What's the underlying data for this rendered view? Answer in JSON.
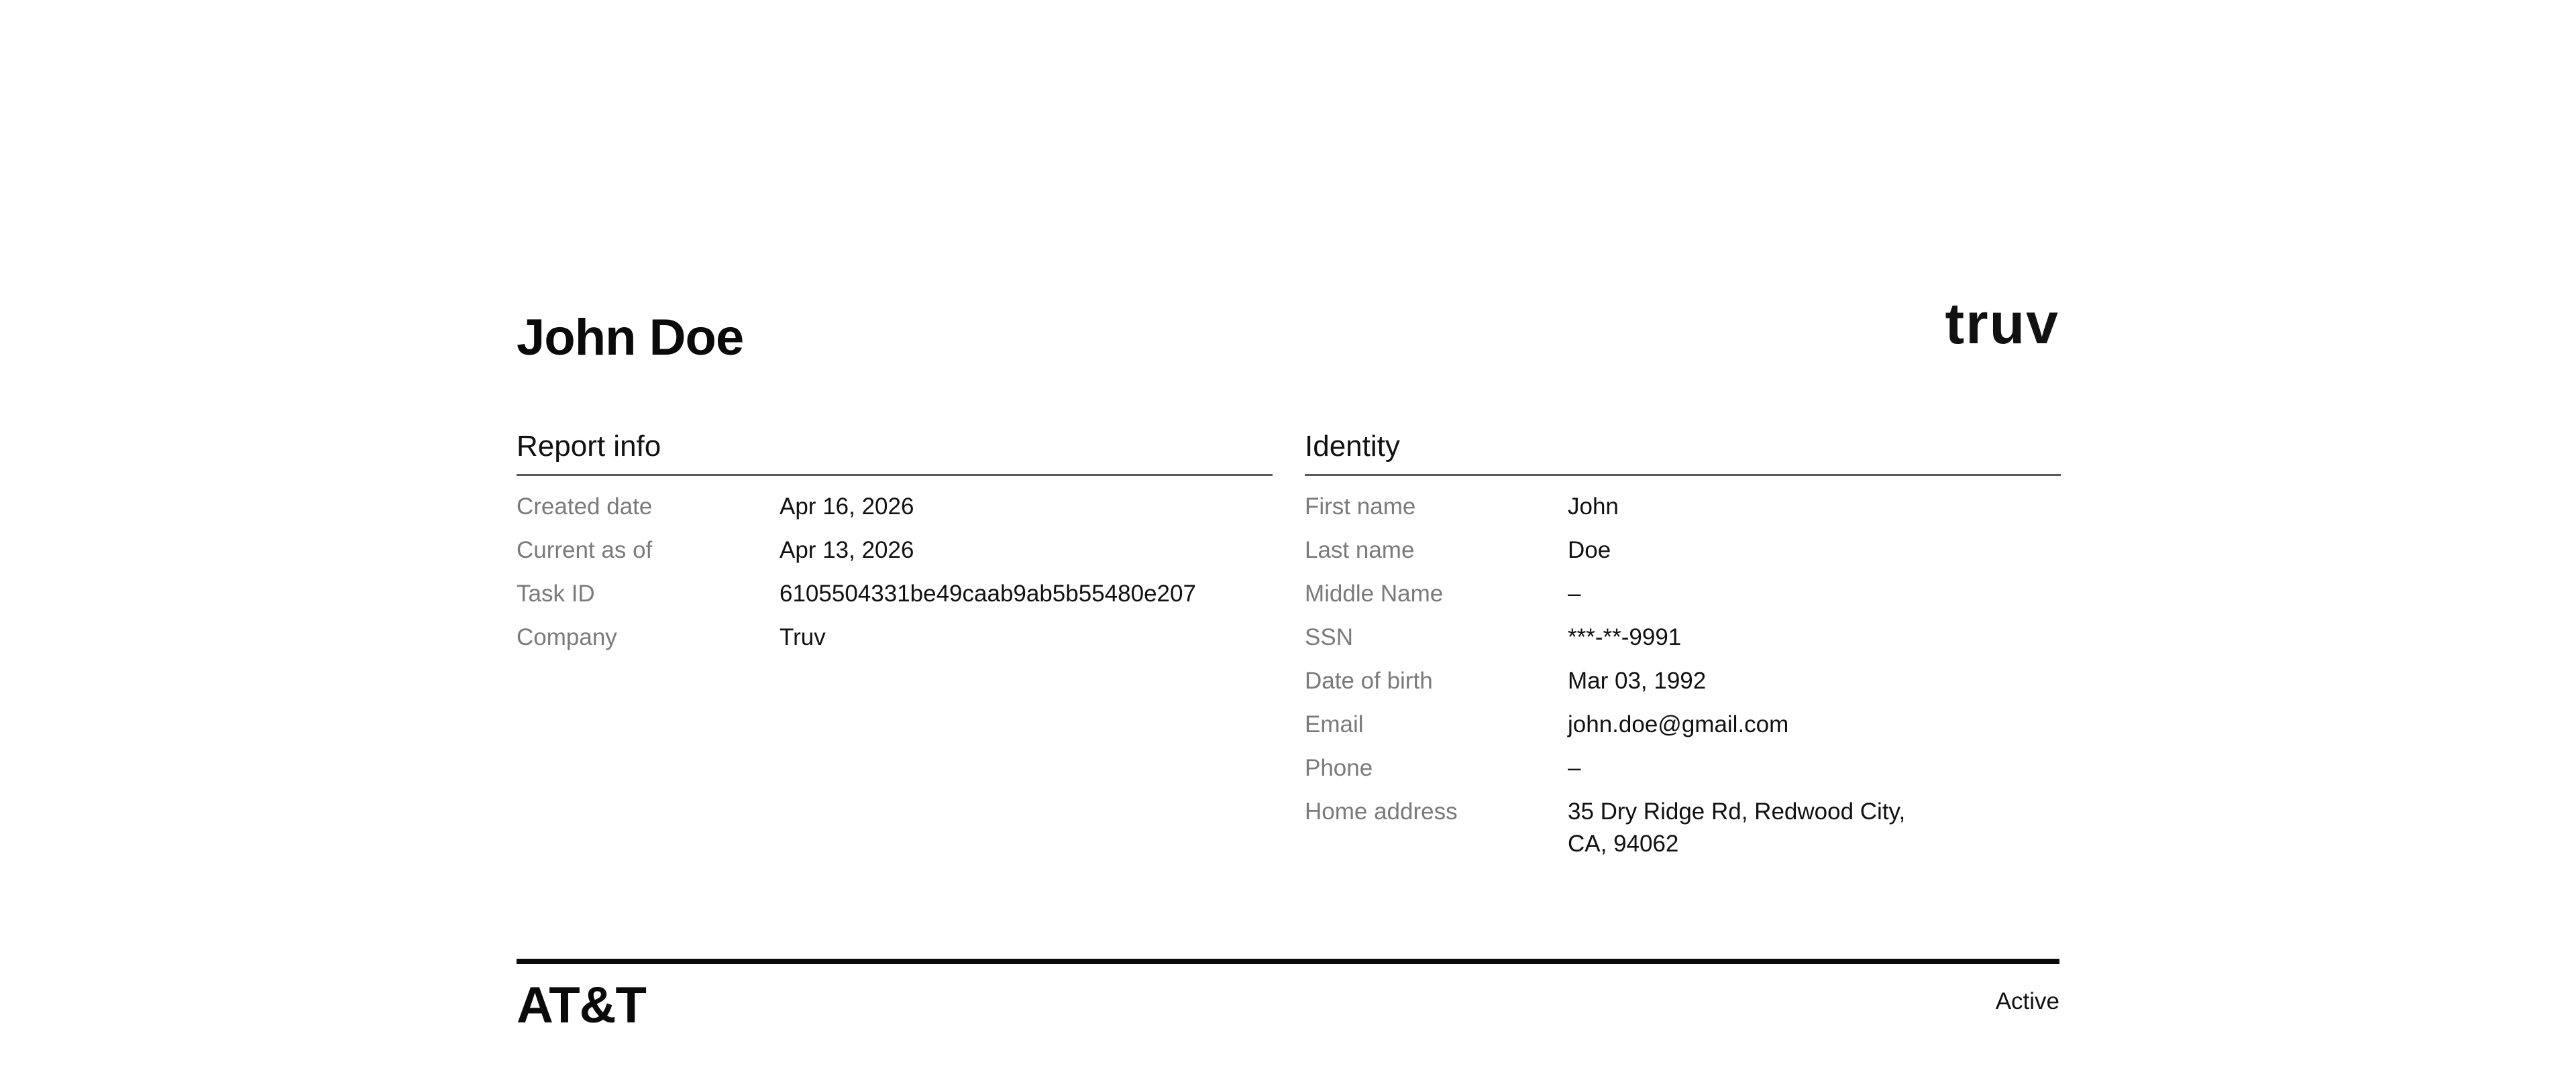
{
  "header": {
    "name": "John Doe",
    "brand": "truv"
  },
  "report_info": {
    "title": "Report info",
    "rows": [
      {
        "label": "Created date",
        "value": "Apr 16, 2026"
      },
      {
        "label": "Current as of",
        "value": "Apr 13, 2026"
      },
      {
        "label": "Task ID",
        "value": "6105504331be49caab9ab5b55480e207"
      },
      {
        "label": "Company",
        "value": "Truv"
      }
    ]
  },
  "identity": {
    "title": "Identity",
    "rows": [
      {
        "label": "First name",
        "value": "John"
      },
      {
        "label": "Last name",
        "value": "Doe"
      },
      {
        "label": "Middle Name",
        "value": "–"
      },
      {
        "label": "SSN",
        "value": "***-**-9991"
      },
      {
        "label": "Date of birth",
        "value": "Mar 03, 1992"
      },
      {
        "label": "Email",
        "value": "john.doe@gmail.com"
      },
      {
        "label": "Phone",
        "value": "–"
      },
      {
        "label": "Home address",
        "value": "35 Dry Ridge Rd, Redwood City, CA, 94062"
      }
    ]
  },
  "footer": {
    "carrier": "AT&T",
    "status": "Active"
  }
}
